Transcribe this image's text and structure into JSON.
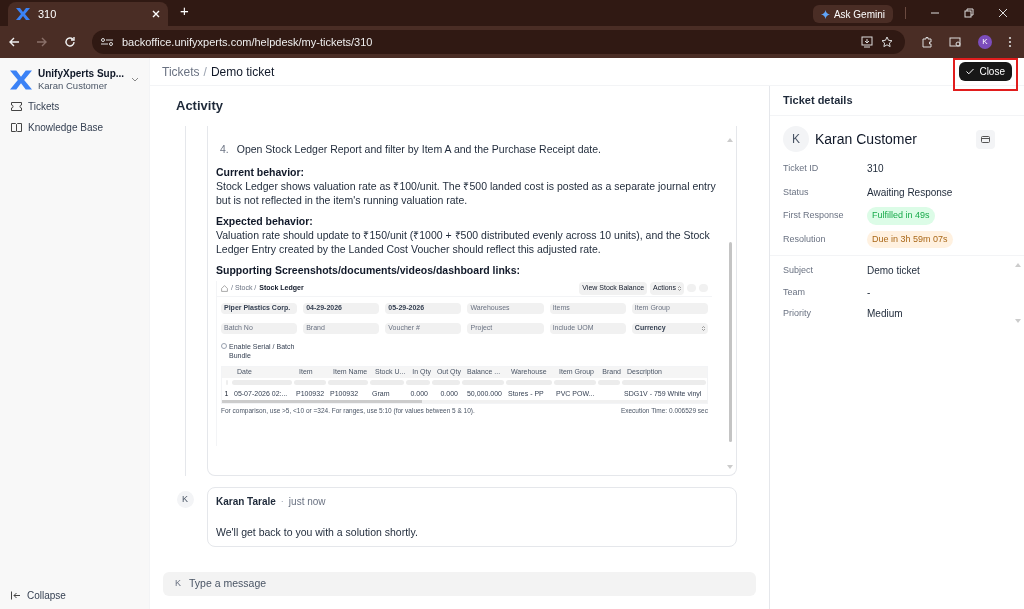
{
  "browser": {
    "tab_title": "310",
    "new_tab": "+",
    "ask_gemini": "Ask Gemini",
    "url": "backoffice.unifyxperts.com/helpdesk/my-tickets/310",
    "profile": "K"
  },
  "sidebar": {
    "workspace": "UnifyXperts Sup...",
    "user": "Karan Customer",
    "items": [
      {
        "label": "Tickets",
        "kind": "tickets"
      },
      {
        "label": "Knowledge Base",
        "kind": "book"
      }
    ],
    "collapse": "Collapse"
  },
  "header": {
    "breadcrumb": [
      "Tickets",
      "Demo ticket"
    ],
    "separator": "/",
    "close_button": "Close"
  },
  "activity": {
    "title": "Activity",
    "step": {
      "number": "4.",
      "text": "Open Stock Ledger Report and filter by Item A and the Purchase Receipt date."
    },
    "sections": [
      {
        "heading": "Current behavior:",
        "text": "Stock Ledger shows valuation rate as ₹100/unit. The ₹500 landed cost is posted as a separate journal entry but is not reflected in the item's running valuation rate."
      },
      {
        "heading": "Expected behavior:",
        "text": "Valuation rate should update to ₹150/unit (₹1000 + ₹500 distributed evenly across 10 units), and the Stock Ledger Entry created by the Landed Cost Voucher should reflect this adjusted rate."
      }
    ],
    "attachments_heading": "Supporting Screenshots/documents/videos/dashboard links:",
    "screenshot": {
      "breadcrumb": [
        "/ Stock /",
        "Stock Ledger"
      ],
      "buttons": [
        "View Stock Balance",
        "Actions"
      ],
      "filters": [
        {
          "value": "Piper Plastics Corp."
        },
        {
          "value": "04-29-2026"
        },
        {
          "value": "05-29-2026"
        },
        {
          "placeholder": "Warehouses"
        },
        {
          "placeholder": "Items"
        },
        {
          "placeholder": "Item Group"
        },
        {
          "placeholder": "Batch No"
        },
        {
          "placeholder": "Brand"
        },
        {
          "placeholder": "Voucher #"
        },
        {
          "placeholder": "Project"
        },
        {
          "placeholder": "Include UOM"
        },
        {
          "value": "Currency",
          "kind": "select"
        }
      ],
      "checkbox": {
        "label": "Enable Serial / Batch Bundle",
        "checked": false
      },
      "columns": [
        "Date",
        "Item",
        "Item Name",
        "Stock U...",
        "In Qty",
        "Out Qty",
        "Balance ...",
        "Warehouse",
        "Item Group",
        "Brand",
        "Description"
      ],
      "rows": [
        {
          "index": "1",
          "cells": [
            "05-07-2026 02:...",
            "P100932",
            "P100932",
            "Gram",
            "0.000",
            "0.000",
            "50,000.000",
            "Stores - PP",
            "PVC POW...",
            "",
            "SDG1V - 759 White vinyl"
          ]
        }
      ],
      "footer_note": "For comparison, use >5, <10 or =324. For ranges, use 5:10 (for values between 5 & 10).",
      "execution_time": "Execution Time: 0.006529 sec"
    }
  },
  "comment": {
    "avatar": "K",
    "author": "Karan Tarale",
    "separator": "·",
    "time": "just now",
    "body": "We'll get back to you with a solution shortly."
  },
  "composer": {
    "avatar": "K",
    "placeholder": "Type a message"
  },
  "details": {
    "title": "Ticket details",
    "contact": {
      "avatar": "K",
      "name": "Karan Customer"
    },
    "fields": [
      {
        "label": "Ticket ID",
        "value": "310",
        "kind": "text"
      },
      {
        "label": "Status",
        "value": "Awaiting Response",
        "kind": "text"
      },
      {
        "label": "First Response",
        "value": "Fulfilled in 49s",
        "kind": "badge",
        "color": "#dcfce7"
      },
      {
        "label": "Resolution",
        "value": "Due in 3h 59m 07s",
        "kind": "badge",
        "color": "#fff1e0"
      }
    ],
    "properties": [
      {
        "label": "Subject",
        "value": "Demo ticket"
      },
      {
        "label": "Team",
        "value": "-"
      },
      {
        "label": "Priority",
        "value": "Medium"
      }
    ]
  }
}
